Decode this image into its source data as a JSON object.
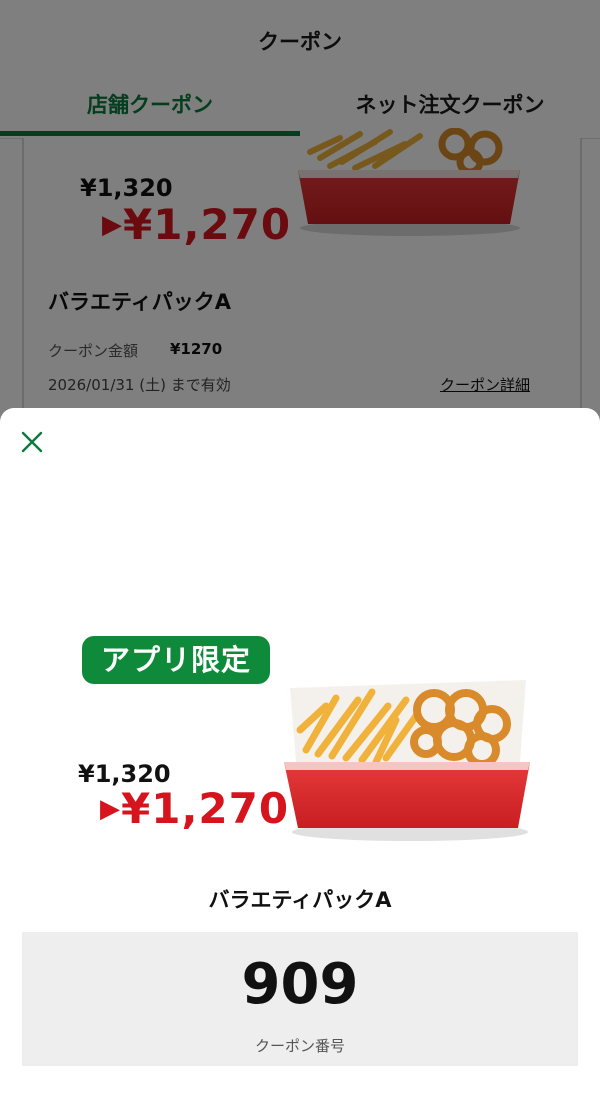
{
  "header": {
    "title": "クーポン"
  },
  "tabs": [
    {
      "label": "店舗クーポン",
      "active": true
    },
    {
      "label": "ネット注文クーポン",
      "active": false
    }
  ],
  "coupon_card": {
    "price_original": "¥1,320",
    "price_arrow": "▶",
    "price_discounted": "¥1,270",
    "item_name": "バラエティパックA",
    "amount_label": "クーポン金額",
    "amount_value": "¥1270",
    "validity": "2026/01/31 (土) まで有効",
    "detail_link": "クーポン詳細"
  },
  "sheet": {
    "close_icon": "close-icon",
    "badge": "アプリ限定",
    "price_original": "¥1,320",
    "price_arrow": "▶",
    "price_discounted": "¥1,270",
    "item_name": "バラエティパックA",
    "coupon_number": "909",
    "coupon_number_label": "クーポン番号"
  },
  "colors": {
    "accent_green": "#0b7a3f",
    "badge_green": "#0f8a3a",
    "price_red": "#d6141e"
  }
}
